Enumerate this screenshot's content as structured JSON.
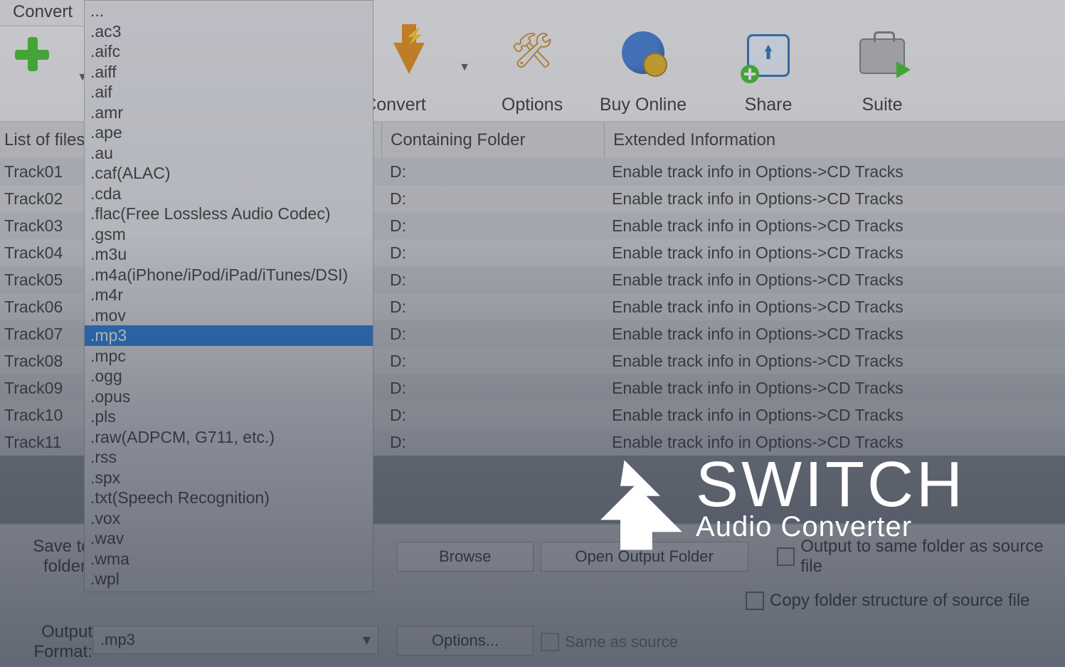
{
  "menu": {
    "convert": "Convert"
  },
  "toolbar": {
    "add_files": "Add File(s)",
    "convert": "Convert",
    "options": "Options",
    "buy_online": "Buy Online",
    "share": "Share",
    "suite": "Suite"
  },
  "list": {
    "header_name": "List of files to convert",
    "header_folder": "Containing Folder",
    "header_ext": "Extended Information",
    "ext_msg": "Enable track info in Options->CD Tracks",
    "folder": "D:",
    "tracks": [
      "Track01",
      "Track02",
      "Track03",
      "Track04",
      "Track05",
      "Track06",
      "Track07",
      "Track08",
      "Track09",
      "Track10",
      "Track11"
    ]
  },
  "bottom": {
    "save_to_label": "Save to folder:",
    "browse": "Browse",
    "open_output": "Open Output Folder",
    "same_output": "Output to same folder as source file",
    "copy_struct": "Copy folder structure of source file",
    "out_format_label": "Output Format:",
    "out_format_value": ".mp3",
    "options_btn": "Options...",
    "same_as_source": "Same as source"
  },
  "formats": {
    "items": [
      "...",
      ".ac3",
      ".aifc",
      ".aiff",
      ".aif",
      ".amr",
      ".ape",
      ".au",
      ".caf(ALAC)",
      ".cda",
      ".flac(Free Lossless Audio Codec)",
      ".gsm",
      ".m3u",
      ".m4a(iPhone/iPod/iPad/iTunes/DSI)",
      ".m4r",
      ".mov",
      ".mp3",
      ".mpc",
      ".ogg",
      ".opus",
      ".pls",
      ".raw(ADPCM, G711, etc.)",
      ".rss",
      ".spx",
      ".txt(Speech Recognition)",
      ".vox",
      ".wav",
      ".wma",
      ".wpl"
    ],
    "selected": ".mp3"
  },
  "brand": {
    "name": "SWITCH",
    "sub": "Audio Converter"
  }
}
